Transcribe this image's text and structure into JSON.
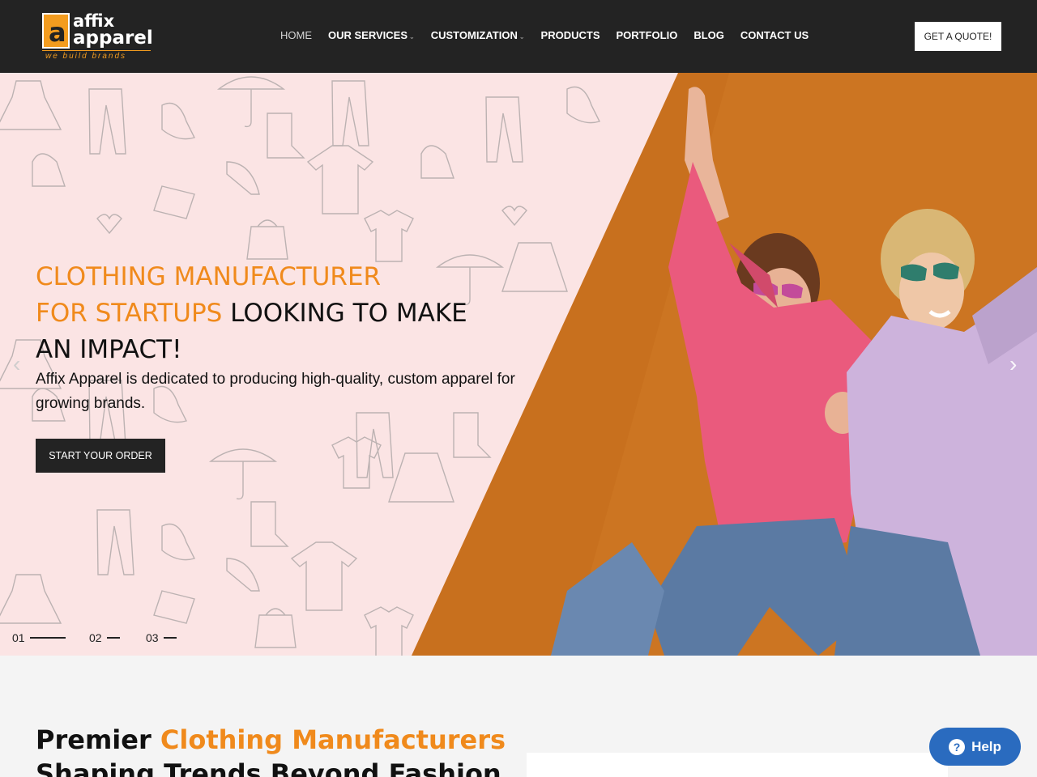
{
  "header": {
    "logo": {
      "line1": "affix",
      "line2": "apparel",
      "tagline": "we build brands",
      "mark": "a"
    },
    "nav": [
      {
        "label": "HOME",
        "active": true,
        "dropdown": false
      },
      {
        "label": "OUR SERVICES",
        "active": false,
        "dropdown": true
      },
      {
        "label": "CUSTOMIZATION",
        "active": false,
        "dropdown": true
      },
      {
        "label": "PRODUCTS",
        "active": false,
        "dropdown": false
      },
      {
        "label": "PORTFOLIO",
        "active": false,
        "dropdown": false
      },
      {
        "label": "BLOG",
        "active": false,
        "dropdown": false
      },
      {
        "label": "CONTACT US",
        "active": false,
        "dropdown": false
      }
    ],
    "cta_label": "GET A QUOTE!"
  },
  "hero": {
    "title_line1": "CLOTHING MANUFACTURER",
    "title_line2_highlight": "FOR STARTUPS",
    "title_line2_rest": " LOOKING TO MAKE",
    "title_line3": "AN IMPACT!",
    "subtitle": "Affix Apparel is dedicated to producing high-quality, custom apparel for growing brands.",
    "button_label": "START YOUR ORDER",
    "slides": [
      "01",
      "02",
      "03"
    ],
    "active_slide": 1
  },
  "section": {
    "title_prefix": "Premier ",
    "title_highlight": "Clothing Manufacturers",
    "title_line2": "Shaping Trends Beyond Fashion"
  },
  "help_widget": {
    "label": "Help",
    "icon": "question-icon"
  },
  "colors": {
    "accent": "#f08a1c",
    "dark": "#232323",
    "hero_bg": "#fbe4e4",
    "photo_bg": "#c8701e",
    "help_blue": "#2a6bbf"
  }
}
